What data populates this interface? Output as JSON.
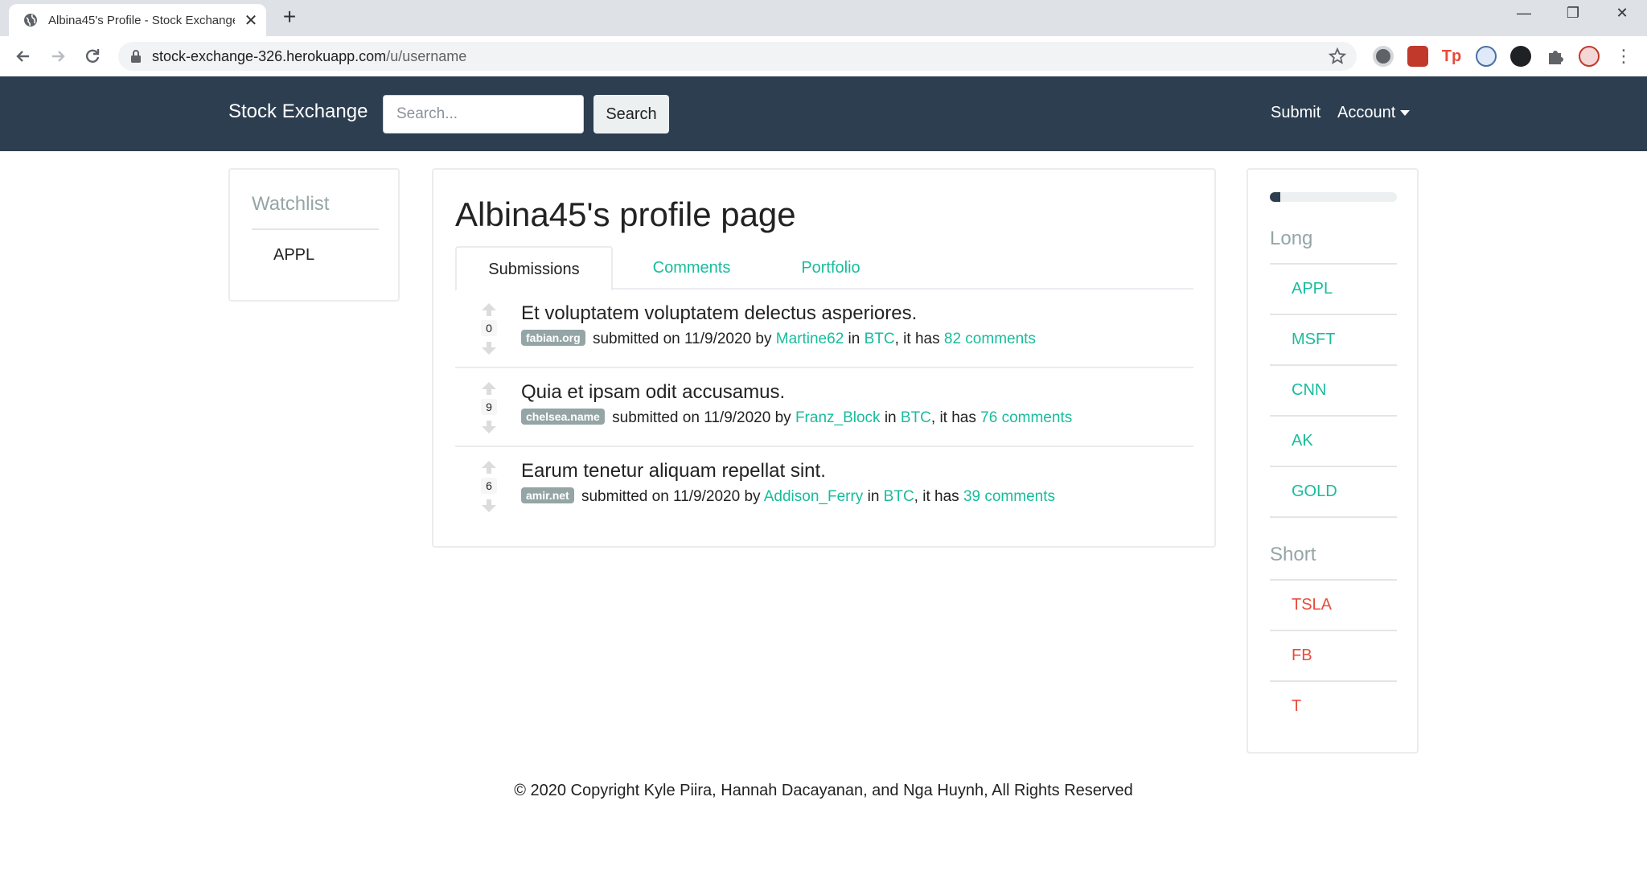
{
  "browser": {
    "tab_title": "Albina45's Profile - Stock Exchange",
    "url_host": "stock-exchange-326.herokuapp.com",
    "url_path": "/u/username"
  },
  "navbar": {
    "brand": "Stock Exchange",
    "search_placeholder": "Search...",
    "search_button": "Search",
    "submit": "Submit",
    "account": "Account"
  },
  "watchlist": {
    "heading": "Watchlist",
    "items": [
      "APPL"
    ]
  },
  "profile": {
    "title": "Albina45's profile page",
    "tabs": [
      "Submissions",
      "Comments",
      "Portfolio"
    ],
    "active_tab": "Submissions",
    "posts": [
      {
        "score": "0",
        "title": "Et voluptatem voluptatem delectus asperiores.",
        "domain": "fabian.org",
        "submitted": "submitted on 11/9/2020 by",
        "author": "Martine62",
        "in_text": "in",
        "community": "BTC",
        "has_text": ", it has",
        "comments": "82 comments"
      },
      {
        "score": "9",
        "title": "Quia et ipsam odit accusamus.",
        "domain": "chelsea.name",
        "submitted": "submitted on 11/9/2020 by",
        "author": "Franz_Block",
        "in_text": "in",
        "community": "BTC",
        "has_text": ", it has",
        "comments": "76 comments"
      },
      {
        "score": "6",
        "title": "Earum tenetur aliquam repellat sint.",
        "domain": "amir.net",
        "submitted": "submitted on 11/9/2020 by",
        "author": "Addison_Ferry",
        "in_text": "in",
        "community": "BTC",
        "has_text": ", it has",
        "comments": "39 comments"
      }
    ]
  },
  "sidebar": {
    "progress": 0.08,
    "long_heading": "Long",
    "long": [
      "APPL",
      "MSFT",
      "CNN",
      "AK",
      "GOLD"
    ],
    "short_heading": "Short",
    "short": [
      "TSLA",
      "FB",
      "T"
    ]
  },
  "footer": "© 2020 Copyright Kyle Piira, Hannah Dacayanan, and Nga Huynh, All Rights Reserved",
  "colors": {
    "navbar": "#2c3e50",
    "link": "#18bc9c",
    "short": "#e74c3c",
    "muted": "#95a5a6"
  }
}
